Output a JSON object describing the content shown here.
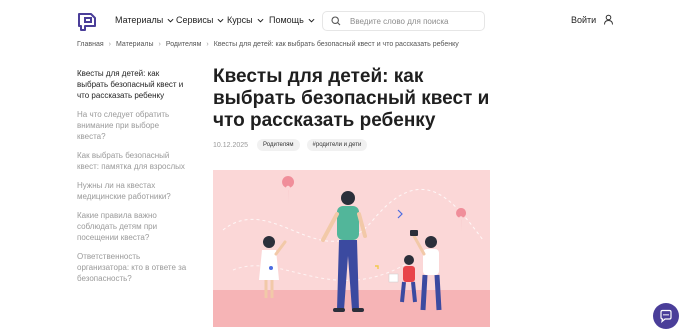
{
  "header": {
    "nav": [
      {
        "label": "Материалы"
      },
      {
        "label": "Сервисы"
      },
      {
        "label": "Курсы"
      },
      {
        "label": "Помощь"
      }
    ],
    "search_placeholder": "Введите слово для поиска",
    "login_label": "Войти"
  },
  "breadcrumb": [
    "Главная",
    "Материалы",
    "Родителям",
    "Квесты для детей: как выбрать безопасный квест и что рассказать ребенку"
  ],
  "toc": [
    "Квесты для детей: как выбрать безопасный квест и что рассказать ребенку",
    "На что следует обратить внимание при выборе квеста?",
    "Как выбрать безопасный квест: памятка для взрослых",
    "Нужны ли на квестах медицинские работники?",
    "Какие правила важно соблюдать детям при посещении квеста?",
    "Ответственность организатора: кто в ответе за безопасность?"
  ],
  "article": {
    "title": "Квесты для детей: как выбрать безопасный квест и что рассказать ребенку",
    "date": "10.12.2025",
    "tags": [
      "Родителям",
      "#родители и дети"
    ]
  },
  "colors": {
    "brand": "#4a3e99",
    "hero_bg": "#fbd7d7",
    "hero_floor": "#f6b4b6"
  }
}
